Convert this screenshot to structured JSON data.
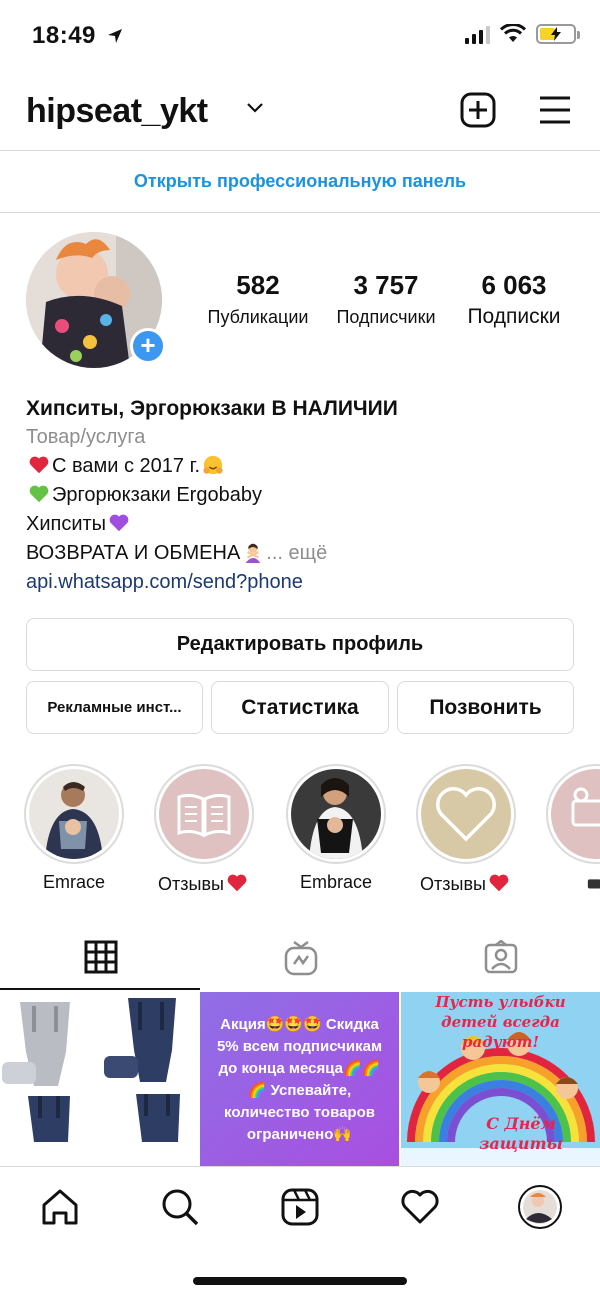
{
  "status": {
    "time": "18:49"
  },
  "header": {
    "username": "hipseat_ykt",
    "icons": [
      "chevron-down-icon",
      "add-post-icon",
      "hamburger-menu-icon"
    ]
  },
  "pro_panel": {
    "label": "Открыть профессиональную панель"
  },
  "stats": [
    {
      "value": "582",
      "label": "Публикации"
    },
    {
      "value": "3 757",
      "label": "Подписчики"
    },
    {
      "value": "6 063",
      "label": "Подписки"
    }
  ],
  "bio": {
    "name": "Хипситы, Эргорюкзаки В НАЛИЧИИ",
    "category": "Товар/услуга",
    "line1": "С вами с 2017 г.",
    "line2": "Эргорюкзаки Ergobaby",
    "line3": "Хипситы",
    "line4": "ВОЗВРАТА И ОБМЕНА",
    "more": "... ещё",
    "link": "api.whatsapp.com/send?phone"
  },
  "buttons": {
    "edit_profile": "Редактировать профиль",
    "ads": "Рекламные инст...",
    "stats": "Статистика",
    "call": "Позвонить"
  },
  "highlights": [
    {
      "label": "Emrace"
    },
    {
      "label": "Отзывы"
    },
    {
      "label": "Embrace"
    },
    {
      "label": "Отзывы"
    },
    {
      "label": ""
    }
  ],
  "tabs": [
    "grid-icon",
    "igtv-icon",
    "tagged-icon"
  ],
  "posts": {
    "promo_text": "Акция🤩🤩🤩 Скидка 5% всем подписчикам до конца месяца🌈🌈🌈 Успевайте, количество товаров ограничено🙌",
    "children_day_title": "Пусть улыбки детей всегда радуют!",
    "children_day_sub": "С Днём защиты"
  },
  "colors": {
    "accent": "#1a93e0",
    "link": "#1b3a6d",
    "border": "#dbdbdb",
    "add_badge": "#3b97f0"
  }
}
